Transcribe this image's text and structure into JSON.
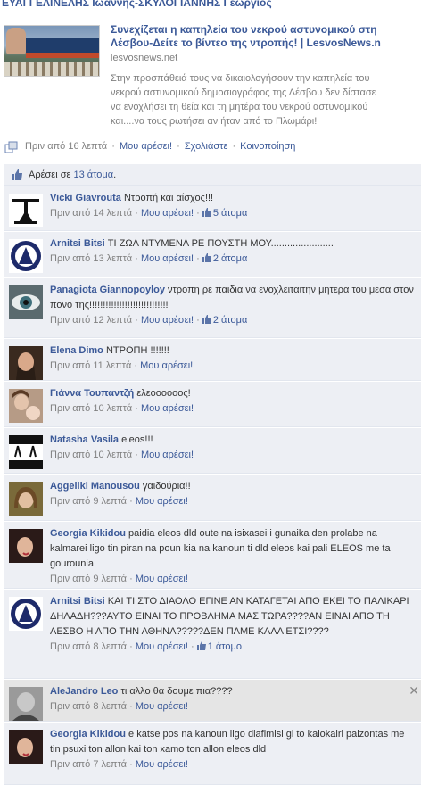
{
  "post": {
    "header_text": "ΕΥΑΓΓΕΛΙΝΕΛΗΣ Ιωάννης-ΣΚΥΛΟΓΙΑΝΝΗΣ Γεώργιος",
    "link_title": "Συνεχίζεται η καπηλεία του νεκρού αστυνομικού στη\nΛέσβου-Δείτε το βίντεο της ντροπής! | LesvosNews.n",
    "link_domain": "lesvosnews.net",
    "link_description": "Στην προσπάθειά τους να δικαιολογήσουν την καπηλεία του\nνεκρού αστυνομικού δημοσιογράφος της Λέσβου δεν δίστασε\nνα ενοχλήσει τη θεία και τη μητέρα του νεκρού αστυνομικού\nκαι....να τους ρωτήσει αν ήταν από το Πλωμάρι!",
    "time": "Πριν από 16 λεπτά",
    "like_link": "Μου αρέσει!",
    "comment_link": "Σχολιάστε",
    "share_link": "Κοινοποίηση"
  },
  "likes": {
    "prefix": "Αρέσει σε",
    "count_link": "13 άτομα",
    "suffix": "."
  },
  "comments": [
    {
      "author": "Vicki Giavrouta",
      "text": "Ντροπή και αίσχος!!!",
      "time": "Πριν από 14 λεπτά",
      "like": "Μου αρέσει!",
      "likes": "5 άτομα"
    },
    {
      "author": "Arnitsi Bitsi",
      "text": "ΤΙ ΖΩΑ ΝΤΥΜΕΝΑ ΡΕ ΠΟΥΣΤΗ ΜΟΥ.......................",
      "time": "Πριν από 13 λεπτά",
      "like": "Μου αρέσει!",
      "likes": "2 άτομα"
    },
    {
      "author": "Panagiota Giannopoylоy",
      "text": "ντροπη ρε παιδια να ενοχλειταιτην μητερα του μεσα στον πονο της!!!!!!!!!!!!!!!!!!!!!!!!!!!!!",
      "time": "Πριν από 12 λεπτά",
      "like": "Μου αρέσει!",
      "likes": "2 άτομα"
    },
    {
      "author": "Elena Dimo",
      "text": "ΝΤΡΟΠΗ !!!!!!!",
      "time": "Πριν από 11 λεπτά",
      "like": "Μου αρέσει!",
      "likes": ""
    },
    {
      "author": "Γιάννα Τουπαντζή",
      "text": "ελεοοοοοος!",
      "time": "Πριν από 10 λεπτά",
      "like": "Μου αρέσει!",
      "likes": ""
    },
    {
      "author": "Natasha Vasila",
      "text": "eleos!!!",
      "time": "Πριν από 10 λεπτά",
      "like": "Μου αρέσει!",
      "likes": ""
    },
    {
      "author": "Aggeliki Manousou",
      "text": "γαιδούρια!!",
      "time": "Πριν από 9 λεπτά",
      "like": "Μου αρέσει!",
      "likes": ""
    },
    {
      "author": "Georgia Kikidou",
      "text": "paidia eleos dld oute na isixasei i gunaika den prolabe na kalmarei ligo tin piran na poun kia na kanoun ti dld eleos kai pali ELEOS me ta gourounia",
      "time": "Πριν από 9 λεπτά",
      "like": "Μου αρέσει!",
      "likes": ""
    },
    {
      "author": "Arnitsi Bitsi",
      "text": "ΚΑΙ ΤΙ ΣΤΟ ΔΙΑΟΛΟ ΕΓΙΝΕ ΑΝ ΚΑΤΑΓΕΤΑΙ ΑΠΟ ΕΚΕΙ ΤΟ ΠΑΛΙΚΑΡΙ ΔΗΛΑΔΗ???ΑΥΤΟ ΕΙΝΑΙ ΤΟ ΠΡΟΒΛΗΜΑ ΜΑΣ ΤΩΡΑ????ΑΝ ΕΙΝΑΙ ΑΠΟ ΤΗ ΛΕΣΒΟ Η ΑΠΟ ΤΗΝ ΑΘΗΝΑ?????ΔΕΝ ΠΑΜΕ ΚΑΛΑ ΕΤΣΙ????",
      "time": "Πριν από 8 λεπτά",
      "like": "Μου αρέσει!",
      "likes": "1 άτομο"
    },
    {
      "author": "AleJandro Leo",
      "text": "τι αλλο θα δουμε πια????",
      "time": "Πριν από 8 λεπτά",
      "like": "Μου αρέσει!",
      "likes": "",
      "close": "✕"
    },
    {
      "author": "Georgia Kikidou",
      "text": "e katse pos na kanoun ligo diafimisi gi to kalokairi paizontas me tin psuxi ton allon kai ton xamo ton allon eleos dld",
      "time": "Πριν από 7 λεπτά",
      "like": "Μου αρέσει!",
      "likes": ""
    }
  ]
}
